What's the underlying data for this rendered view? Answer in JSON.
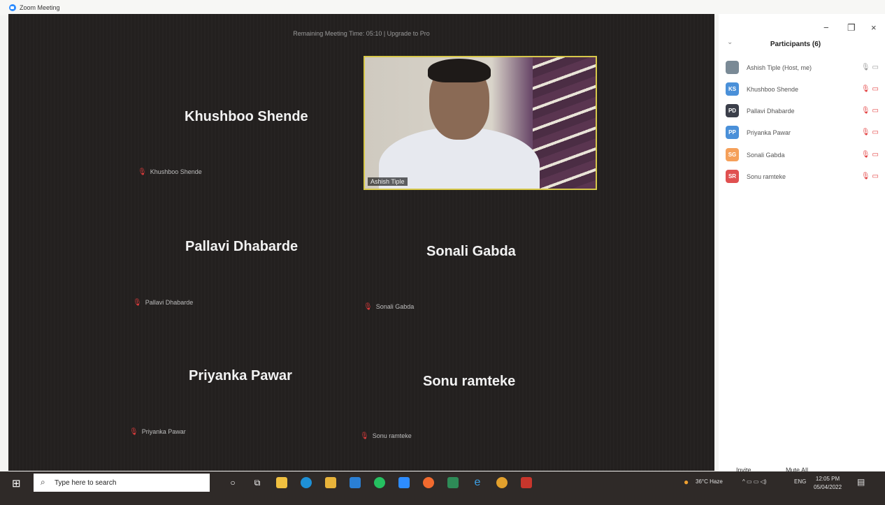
{
  "window": {
    "title": "Zoom Meeting"
  },
  "meeting": {
    "banner": "Remaining Meeting Time: 05:10 | Upgrade to Pro",
    "video_label": "Ashish Tiple",
    "tiles": [
      {
        "name": "Khushboo Shende",
        "label": "Khushboo Shende"
      },
      {
        "name": "Pallavi Dhabarde",
        "label": "Pallavi Dhabarde"
      },
      {
        "name": "Sonali  Gabda",
        "label": "Sonali  Gabda"
      },
      {
        "name": "Priyanka Pawar",
        "label": "Priyanka Pawar"
      },
      {
        "name": "Sonu ramteke",
        "label": "Sonu ramteke"
      }
    ]
  },
  "panel": {
    "title": "Participants (6)",
    "controls": {
      "minimize": "−",
      "restore": "❐",
      "close": "×",
      "collapse": "⌄"
    },
    "participants": [
      {
        "initials": "",
        "name": "Ashish Tiple (Host, me)",
        "color": "#7a8a96"
      },
      {
        "initials": "KS",
        "name": "Khushboo Shende",
        "color": "#4a90d9"
      },
      {
        "initials": "PD",
        "name": "Pallavi Dhabarde",
        "color": "#3b3f4a"
      },
      {
        "initials": "PP",
        "name": "Priyanka Pawar",
        "color": "#4a90d9"
      },
      {
        "initials": "SG",
        "name": "Sonali  Gabda",
        "color": "#f5a05a"
      },
      {
        "initials": "SR",
        "name": "Sonu ramteke",
        "color": "#e05050"
      }
    ],
    "invite": "Invite",
    "mute_all": "Mute All",
    "more": "..."
  },
  "taskbar": {
    "search_placeholder": "Type here to search",
    "weather": "36°C  Haze",
    "tray_icons": "^  ▭  ▭  ◁)",
    "language": "ENG",
    "time": "12:05 PM",
    "date": "05/04/2022"
  },
  "colors": {
    "accent": "#2d8cff",
    "muted": "#e23c3c",
    "active_border": "#d7c84a"
  }
}
